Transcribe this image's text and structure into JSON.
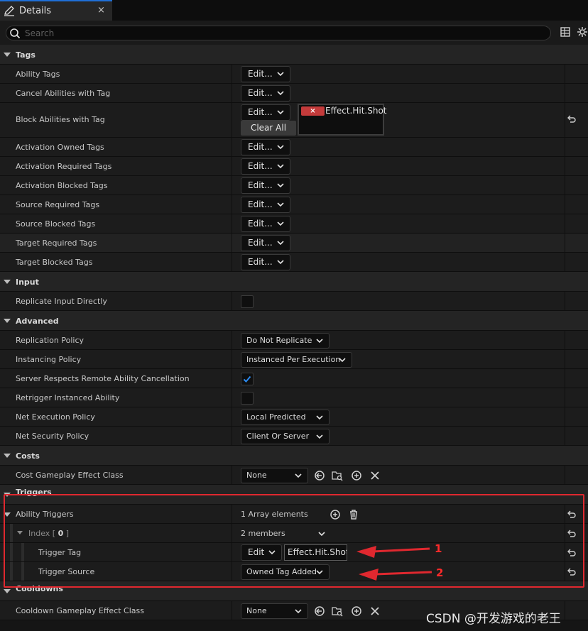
{
  "tab": {
    "title": "Details",
    "close": "×"
  },
  "search": {
    "placeholder": "Search",
    "value": ""
  },
  "rows": {
    "tags": {
      "label": "Tags"
    },
    "ability_tags": {
      "label": "Ability Tags",
      "button": "Edit..."
    },
    "cancel_abilities": {
      "label": "Cancel Abilities with Tag",
      "button": "Edit..."
    },
    "block_abilities": {
      "label": "Block Abilities with Tag",
      "button": "Edit...",
      "tag": "Effect.Hit.Shot",
      "tag_remove": "×",
      "clear": "Clear All"
    },
    "activation_owned": {
      "label": "Activation Owned Tags",
      "button": "Edit..."
    },
    "activation_required": {
      "label": "Activation Required Tags",
      "button": "Edit..."
    },
    "activation_blocked": {
      "label": "Activation Blocked Tags",
      "button": "Edit..."
    },
    "source_required": {
      "label": "Source Required Tags",
      "button": "Edit..."
    },
    "source_blocked": {
      "label": "Source Blocked Tags",
      "button": "Edit..."
    },
    "target_required": {
      "label": "Target Required Tags",
      "button": "Edit..."
    },
    "target_blocked": {
      "label": "Target Blocked Tags",
      "button": "Edit..."
    },
    "input": {
      "label": "Input"
    },
    "replicate_input": {
      "label": "Replicate Input Directly",
      "checked": false
    },
    "advanced": {
      "label": "Advanced"
    },
    "replication_policy": {
      "label": "Replication Policy",
      "value": "Do Not Replicate"
    },
    "instancing_policy": {
      "label": "Instancing Policy",
      "value": "Instanced Per Execution"
    },
    "server_respects": {
      "label": "Server Respects Remote Ability Cancellation",
      "checked": true
    },
    "retrigger": {
      "label": "Retrigger Instanced Ability",
      "checked": false
    },
    "net_execution": {
      "label": "Net Execution Policy",
      "value": "Local Predicted"
    },
    "net_security": {
      "label": "Net Security Policy",
      "value": "Client Or Server"
    },
    "costs": {
      "label": "Costs"
    },
    "cost_effect": {
      "label": "Cost Gameplay Effect Class",
      "value": "None"
    },
    "triggers": {
      "label": "Triggers"
    },
    "ability_triggers": {
      "label": "Ability Triggers",
      "count": "1 Array elements"
    },
    "index0": {
      "label_prefix": "Index [ ",
      "label_index": "0",
      "label_suffix": " ]",
      "members": "2 members"
    },
    "trigger_tag": {
      "label": "Trigger Tag",
      "button": "Edit",
      "value": "Effect.Hit.Shot"
    },
    "trigger_source": {
      "label": "Trigger Source",
      "value": "Owned Tag Added"
    },
    "cooldowns": {
      "label": "Cooldowns"
    },
    "cooldown_effect": {
      "label": "Cooldown Gameplay Effect Class",
      "value": "None"
    }
  },
  "annotations": {
    "arrow1": "1",
    "arrow2": "2"
  },
  "watermark": "CSDN @开发游戏的老王",
  "colors": {
    "accent": "#1f6fd6",
    "annotation": "#e0282f",
    "checkbox_mark": "#2b8af0"
  }
}
